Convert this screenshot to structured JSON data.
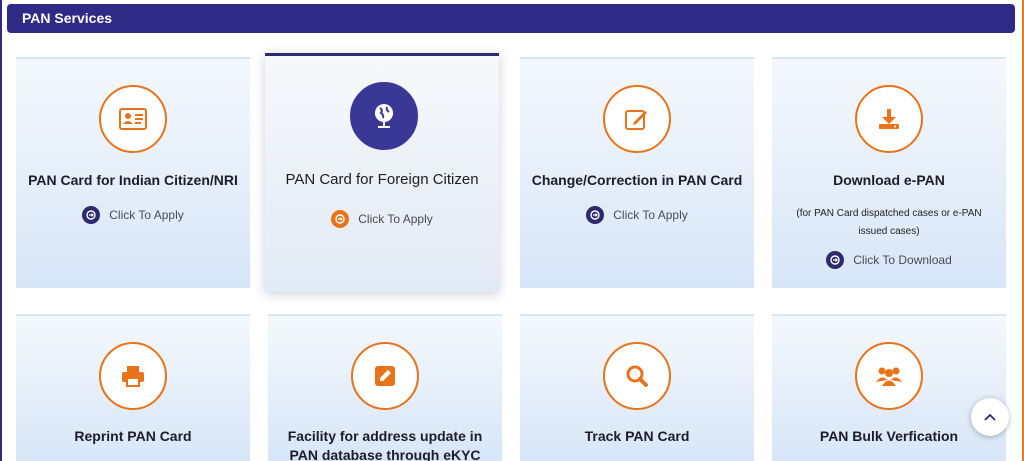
{
  "section": {
    "title": "PAN Services"
  },
  "cards": [
    {
      "title": "PAN Card for Indian Citizen/NRI",
      "action": "Click To Apply",
      "icon": "id-card-icon"
    },
    {
      "title": "PAN Card for Foreign Citizen",
      "action": "Click To Apply",
      "icon": "globe-icon"
    },
    {
      "title": "Change/Correction in PAN Card",
      "action": "Click To Apply",
      "icon": "edit-icon"
    },
    {
      "title": "Download e-PAN",
      "note_line1": "(for PAN Card dispatched cases or e-PAN",
      "note_line2": "issued cases)",
      "action": "Click To Download",
      "icon": "download-icon"
    },
    {
      "title": "Reprint PAN Card",
      "icon": "printer-icon"
    },
    {
      "title_line1": "Facility for address update in",
      "title_line2": "PAN database through eKYC",
      "icon": "pencil-square-icon"
    },
    {
      "title": "Track PAN Card",
      "icon": "search-icon"
    },
    {
      "title": "PAN Bulk Verfication",
      "icon": "users-group-icon"
    }
  ],
  "colors": {
    "header": "#2e2a85",
    "accent": "#e8731a",
    "navy": "#2d2a6e"
  },
  "scroll_top": {
    "icon": "chevron-up-icon"
  }
}
